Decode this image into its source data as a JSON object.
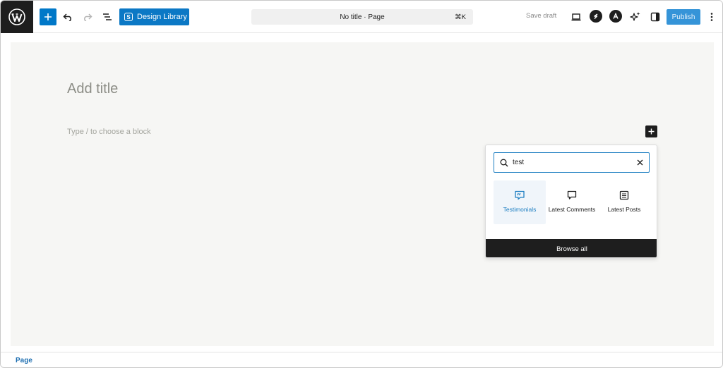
{
  "header": {
    "design_library_label": "Design Library",
    "design_library_logo": "S",
    "doc_title": "No title · Page",
    "shortcut": "⌘K",
    "save_draft": "Save draft",
    "publish": "Publish",
    "icons": [
      "wordpress-logo-icon",
      "plus-icon",
      "undo-icon",
      "redo-icon",
      "document-overview-icon",
      "design-library-icon",
      "desktop-preview-icon",
      "stackable-icon",
      "spectra-icon",
      "ai-sparkle-icon",
      "settings-sidebar-icon",
      "more-options-icon"
    ]
  },
  "canvas": {
    "title_placeholder": "Add title",
    "block_placeholder": "Type / to choose a block"
  },
  "inserter": {
    "search_value": "test",
    "results": [
      {
        "label": "Testimonials",
        "icon": "testimonial-quote-icon",
        "active": true
      },
      {
        "label": "Latest Comments",
        "icon": "comment-icon",
        "active": false
      },
      {
        "label": "Latest Posts",
        "icon": "post-list-icon",
        "active": false
      }
    ],
    "browse_all": "Browse all"
  },
  "footer": {
    "breadcrumb": "Page"
  },
  "colors": {
    "accent": "#0b78c5",
    "dark": "#1e1e1e",
    "canvas_bg": "#f6f6f4",
    "publish_bg": "#3594d8"
  }
}
